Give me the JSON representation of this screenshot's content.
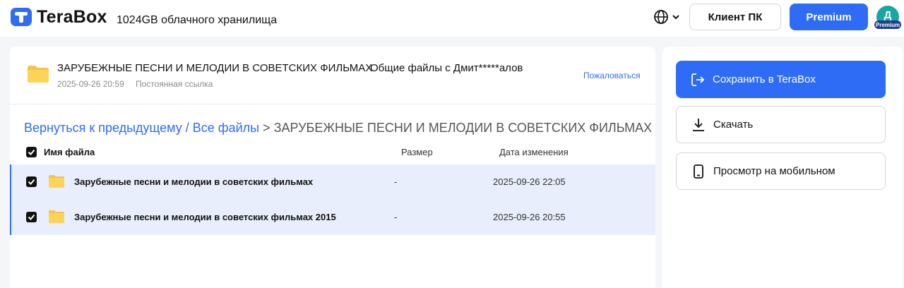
{
  "header": {
    "brand": "TeraBox",
    "storage": "1024GB облачного хранилища",
    "pc_client_label": "Клиент ПК",
    "premium_label": "Premium",
    "avatar_letter": "Д",
    "avatar_badge": "Premium",
    "accent_color": "#2f6cf6"
  },
  "share": {
    "title": "ЗАРУБЕЖНЫЕ ПЕСНИ И МЕЛОДИИ В СОВЕТСКИХ ФИЛЬМАХ",
    "owner": "Общие файлы с Дмит*****алов",
    "date": "2025-09-26 20:59",
    "link_type": "Постоянная ссылка",
    "report_label": "Пожаловаться"
  },
  "breadcrumb": {
    "back": "Вернуться к предыдущему",
    "separator": " / ",
    "all_files": "Все файлы",
    "arrow": " > ",
    "current": "ЗАРУБЕЖНЫЕ ПЕСНИ И МЕЛОДИИ В СОВЕТСКИХ ФИЛЬМАХ"
  },
  "table": {
    "columns": {
      "name": "Имя файла",
      "size": "Размер",
      "date": "Дата изменения"
    },
    "rows": [
      {
        "name": "Зарубежные песни и мелодии в советских фильмах",
        "size": "-",
        "date": "2025-09-26 22:05",
        "checked": true,
        "icon": "folder-icon"
      },
      {
        "name": "Зарубежные песни и мелодии в советских фильмах 2015",
        "size": "-",
        "date": "2025-09-26 20:55",
        "checked": true,
        "icon": "folder-icon"
      }
    ]
  },
  "actions": {
    "save": "Сохранить в TeraBox",
    "download": "Скачать",
    "mobile": "Просмотр на мобильном"
  }
}
